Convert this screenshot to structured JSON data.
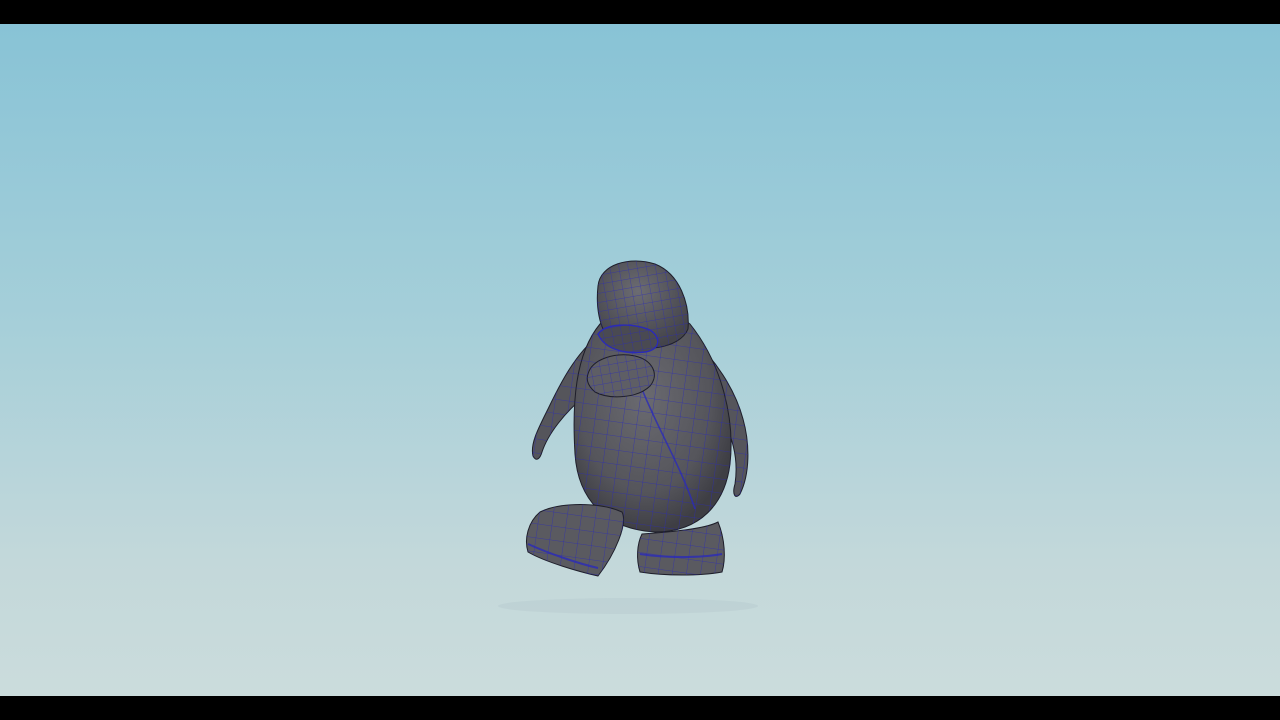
{
  "viewport": {
    "background_top": "#88c3d6",
    "background_bottom": "#cbdcdc",
    "model_color": "#5b5b62",
    "wire_color": "#2a2ab8",
    "model_name": "penguin-mesh-icon"
  }
}
